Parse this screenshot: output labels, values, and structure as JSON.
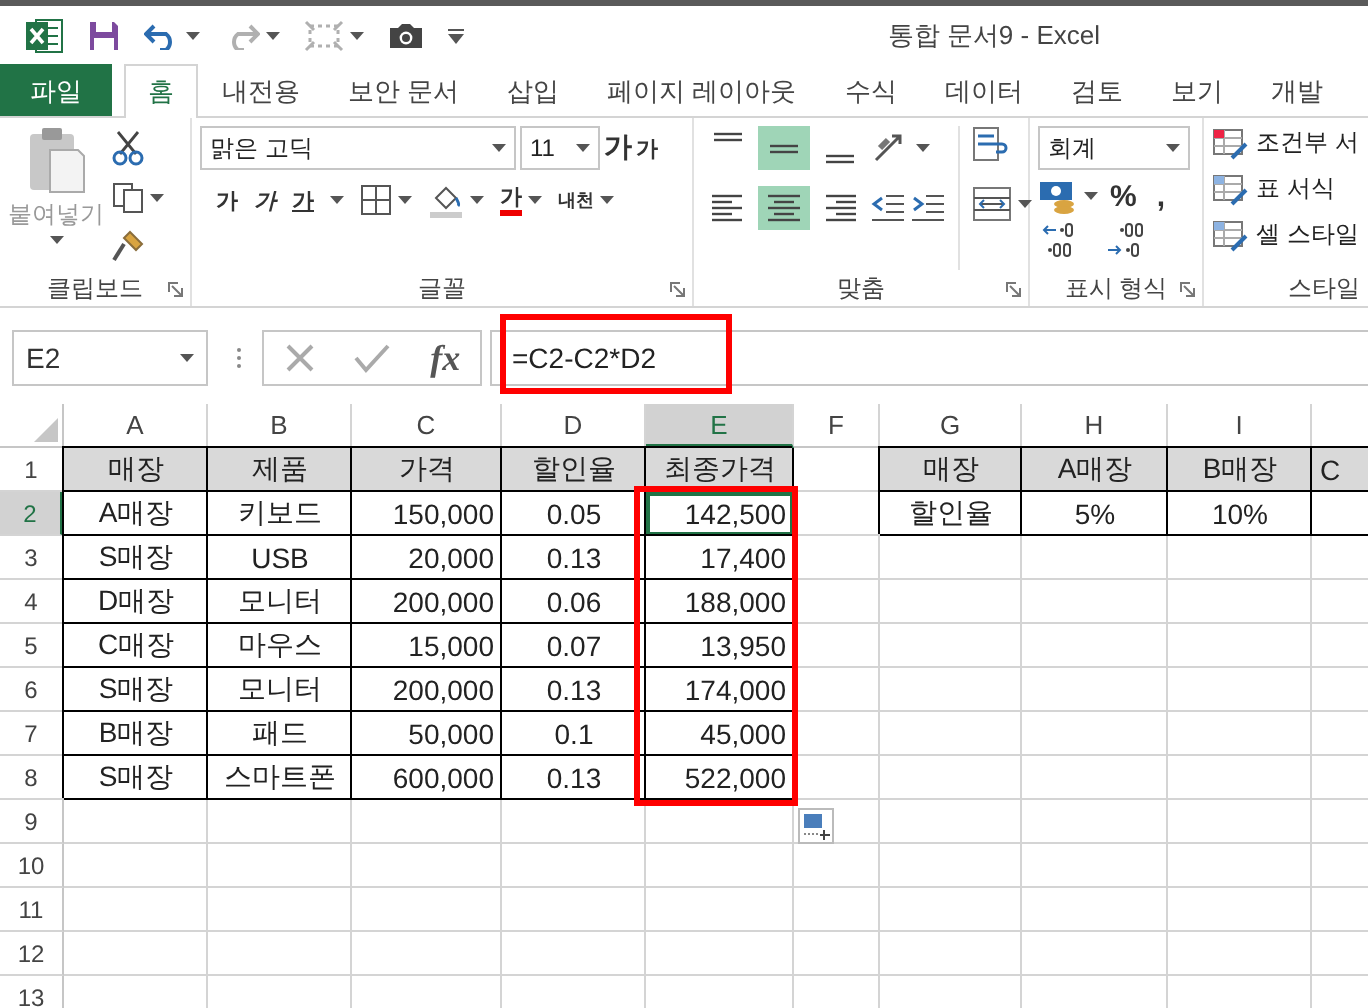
{
  "window": {
    "title": "통합 문서9 - Excel"
  },
  "quick_access": [
    {
      "kind": "save",
      "disabled": false
    },
    {
      "kind": "undo",
      "disabled": false
    },
    {
      "kind": "redo",
      "disabled": true
    },
    {
      "kind": "touch",
      "disabled": true
    },
    {
      "kind": "camera",
      "disabled": false
    },
    {
      "kind": "customize",
      "disabled": false
    }
  ],
  "tabs": [
    {
      "label": "파일",
      "kind": "file",
      "selected": false
    },
    {
      "label": "홈",
      "kind": "tab",
      "selected": true
    },
    {
      "label": "내전용",
      "kind": "tab",
      "selected": false
    },
    {
      "label": "보안 문서",
      "kind": "tab",
      "selected": false
    },
    {
      "label": "삽입",
      "kind": "tab",
      "selected": false
    },
    {
      "label": "페이지 레이아웃",
      "kind": "tab",
      "selected": false
    },
    {
      "label": "수식",
      "kind": "tab",
      "selected": false
    },
    {
      "label": "데이터",
      "kind": "tab",
      "selected": false
    },
    {
      "label": "검토",
      "kind": "tab",
      "selected": false
    },
    {
      "label": "보기",
      "kind": "tab",
      "selected": false
    },
    {
      "label": "개발",
      "kind": "tab",
      "selected": false
    }
  ],
  "ribbon": {
    "clipboard": {
      "label": "클립보드",
      "paste": "붙여넣기",
      "paste_disabled": true
    },
    "font": {
      "label": "글꼴",
      "face": "맑은 고딕",
      "size": "11",
      "grow": "가",
      "shrink": "가",
      "bold": "가",
      "italic": "가",
      "underline": "가",
      "font_color": "가",
      "phonetic": "내천"
    },
    "alignment": {
      "label": "맞춤",
      "buttons": [
        {
          "kind": "top",
          "selected": false
        },
        {
          "kind": "middle",
          "selected": true
        },
        {
          "kind": "bottom",
          "selected": false
        },
        {
          "kind": "left",
          "selected": false
        },
        {
          "kind": "center",
          "selected": true
        },
        {
          "kind": "right",
          "selected": false
        }
      ]
    },
    "number": {
      "label": "표시 형식",
      "format": "회계",
      "percent": "%",
      "comma": ","
    },
    "styles": {
      "label": "스타일",
      "items": [
        {
          "kind": "conditional",
          "label": "조건부 서"
        },
        {
          "kind": "table",
          "label": "표 서식"
        },
        {
          "kind": "cell",
          "label": "셀 스타일"
        }
      ]
    }
  },
  "formula_bar": {
    "name_box": "E2",
    "function_button": "fx",
    "formula": "=C2-C2*D2"
  },
  "sheet": {
    "columns": [
      {
        "letter": "A",
        "selected": false
      },
      {
        "letter": "B",
        "selected": false
      },
      {
        "letter": "C",
        "selected": false
      },
      {
        "letter": "D",
        "selected": false
      },
      {
        "letter": "E",
        "selected": true
      },
      {
        "letter": "F",
        "selected": false
      },
      {
        "letter": "G",
        "selected": false
      },
      {
        "letter": "H",
        "selected": false
      },
      {
        "letter": "I",
        "selected": false
      }
    ],
    "rows": [
      {
        "number": "1",
        "selected": false,
        "cells": [
          {
            "text": "매장",
            "kind": "header",
            "selected": false
          },
          {
            "text": "제품",
            "kind": "header",
            "selected": false
          },
          {
            "text": "가격",
            "kind": "header",
            "selected": false
          },
          {
            "text": "할인율",
            "kind": "header",
            "selected": false
          },
          {
            "text": "최종가격",
            "kind": "header",
            "selected": false
          },
          {
            "kind": "empty",
            "selected": false
          },
          {
            "text": "매장",
            "kind": "header",
            "selected": false
          },
          {
            "text": "A매장",
            "kind": "header",
            "selected": false
          },
          {
            "text": "B매장",
            "kind": "header",
            "selected": false
          },
          {
            "text": "C",
            "kind": "header",
            "selected": false
          }
        ]
      },
      {
        "number": "2",
        "selected": true,
        "cells": [
          {
            "text": "A매장",
            "kind": "data",
            "selected": false
          },
          {
            "text": "키보드",
            "kind": "data",
            "selected": false
          },
          {
            "text": "150,000",
            "kind": "data",
            "selected": false
          },
          {
            "text": "0.05",
            "kind": "data",
            "selected": false
          },
          {
            "text": "142,500",
            "kind": "data",
            "selected": true
          },
          {
            "kind": "empty",
            "selected": false
          },
          {
            "text": "할인율",
            "kind": "data",
            "selected": false
          },
          {
            "text": "5%",
            "kind": "data",
            "selected": false
          },
          {
            "text": "10%",
            "kind": "data",
            "selected": false
          },
          {
            "kind": "data",
            "selected": false
          }
        ]
      },
      {
        "number": "3",
        "selected": false,
        "cells": [
          {
            "text": "S매장",
            "kind": "data",
            "selected": false
          },
          {
            "text": "USB",
            "kind": "data",
            "selected": false
          },
          {
            "text": "20,000",
            "kind": "data",
            "selected": false
          },
          {
            "text": "0.13",
            "kind": "data",
            "selected": false
          },
          {
            "text": "17,400",
            "kind": "data",
            "selected": false
          }
        ]
      },
      {
        "number": "4",
        "selected": false,
        "cells": [
          {
            "text": "D매장",
            "kind": "data",
            "selected": false
          },
          {
            "text": "모니터",
            "kind": "data",
            "selected": false
          },
          {
            "text": "200,000",
            "kind": "data",
            "selected": false
          },
          {
            "text": "0.06",
            "kind": "data",
            "selected": false
          },
          {
            "text": "188,000",
            "kind": "data",
            "selected": false
          }
        ]
      },
      {
        "number": "5",
        "selected": false,
        "cells": [
          {
            "text": "C매장",
            "kind": "data",
            "selected": false
          },
          {
            "text": "마우스",
            "kind": "data",
            "selected": false
          },
          {
            "text": "15,000",
            "kind": "data",
            "selected": false
          },
          {
            "text": "0.07",
            "kind": "data",
            "selected": false
          },
          {
            "text": "13,950",
            "kind": "data",
            "selected": false
          }
        ]
      },
      {
        "number": "6",
        "selected": false,
        "cells": [
          {
            "text": "S매장",
            "kind": "data",
            "selected": false
          },
          {
            "text": "모니터",
            "kind": "data",
            "selected": false
          },
          {
            "text": "200,000",
            "kind": "data",
            "selected": false
          },
          {
            "text": "0.13",
            "kind": "data",
            "selected": false
          },
          {
            "text": "174,000",
            "kind": "data",
            "selected": false
          }
        ]
      },
      {
        "number": "7",
        "selected": false,
        "cells": [
          {
            "text": "B매장",
            "kind": "data",
            "selected": false
          },
          {
            "text": "패드",
            "kind": "data",
            "selected": false
          },
          {
            "text": "50,000",
            "kind": "data",
            "selected": false
          },
          {
            "text": "0.1",
            "kind": "data",
            "selected": false
          },
          {
            "text": "45,000",
            "kind": "data",
            "selected": false
          }
        ]
      },
      {
        "number": "8",
        "selected": false,
        "cells": [
          {
            "text": "S매장",
            "kind": "data",
            "selected": false
          },
          {
            "text": "스마트폰",
            "kind": "data",
            "selected": false
          },
          {
            "text": "600,000",
            "kind": "data",
            "selected": false
          },
          {
            "text": "0.13",
            "kind": "data",
            "selected": false
          },
          {
            "text": "522,000",
            "kind": "data",
            "selected": false
          }
        ]
      },
      {
        "number": "9",
        "selected": false
      },
      {
        "number": "10",
        "selected": false
      },
      {
        "number": "11",
        "selected": false
      },
      {
        "number": "12",
        "selected": false
      },
      {
        "number": "13",
        "selected": false
      }
    ]
  },
  "highlights": {
    "formula": true,
    "column": true
  }
}
